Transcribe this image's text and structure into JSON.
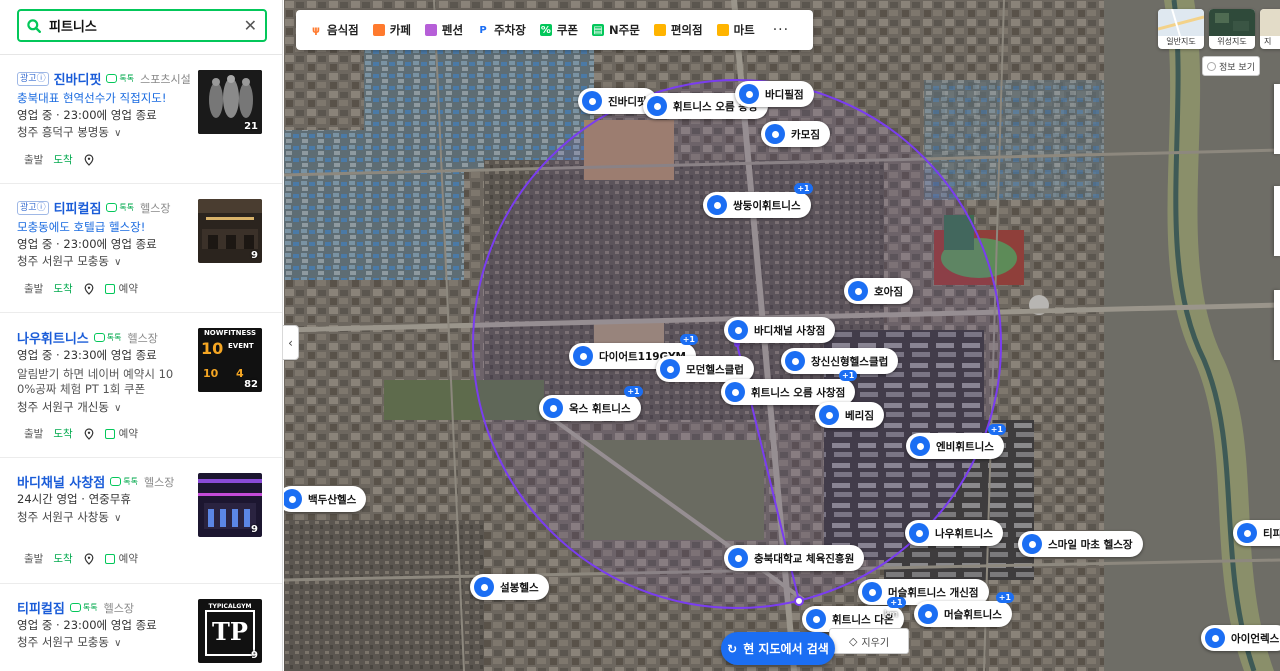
{
  "search": {
    "value": "피트니스",
    "clear_icon": "close-icon"
  },
  "places": [
    {
      "ad": "광고",
      "name": "진바디핏",
      "talk": "톡톡",
      "category": "스포츠시설",
      "promo": "충북대표 현역선수가 직접지도!",
      "status": "영업 중",
      "hours": "23:00에 영업 종료",
      "extra": "",
      "address": "청주 흥덕구 봉명동",
      "depart": "출발",
      "arrive": "도착",
      "reserve": "",
      "photo_count": "21"
    },
    {
      "ad": "광고",
      "name": "티피컬짐",
      "talk": "톡톡",
      "category": "헬스장",
      "promo": "모충동에도 호텔급 헬스장!",
      "status": "영업 중",
      "hours": "23:00에 영업 종료",
      "extra": "",
      "address": "청주 서원구 모충동",
      "depart": "출발",
      "arrive": "도착",
      "reserve": "예약",
      "photo_count": "9"
    },
    {
      "ad": "",
      "name": "나우휘트니스",
      "talk": "톡톡",
      "category": "헬스장",
      "promo": "",
      "status": "영업 중",
      "hours": "23:30에 영업 종료",
      "extra": "알림받기 하면 네이버 예약시 10",
      "extra2": "0%공짜 체험 PT 1회 쿠폰",
      "address": "청주 서원구 개신동",
      "depart": "출발",
      "arrive": "도착",
      "reserve": "예약",
      "photo_count": "82",
      "thumb_text": [
        "NOWFITNESS",
        "10",
        "EVENT",
        "10",
        "4"
      ]
    },
    {
      "ad": "",
      "name": "바디채널 사창점",
      "talk": "톡톡",
      "category": "헬스장",
      "promo": "",
      "status": "24시간 영업",
      "hours": "연중무휴",
      "extra": "",
      "address": "청주 서원구 사창동",
      "depart": "출발",
      "arrive": "도착",
      "reserve": "예약",
      "photo_count": "9"
    },
    {
      "ad": "",
      "name": "티피컬짐",
      "talk": "톡톡",
      "category": "헬스장",
      "promo": "",
      "status": "영업 중",
      "hours": "23:00에 영업 종료",
      "extra": "",
      "address": "청주 서원구 모충동",
      "depart": "",
      "arrive": "",
      "reserve": "",
      "photo_count": "9",
      "thumb_text": [
        "TYPICALGYM",
        "TP"
      ]
    }
  ],
  "categories": [
    {
      "label": "음식점",
      "icon": "fork-icon",
      "color": "#ff7a2e"
    },
    {
      "label": "카페",
      "icon": "cup-icon",
      "color": "#ff7a2e"
    },
    {
      "label": "펜션",
      "icon": "bed-icon",
      "color": "#b65fd8"
    },
    {
      "label": "주차장",
      "icon": "parking-icon",
      "color": "#1b6ef3"
    },
    {
      "label": "쿠폰",
      "icon": "coupon-icon",
      "color": "#03c75a"
    },
    {
      "label": "N주문",
      "icon": "order-icon",
      "color": "#03c75a"
    },
    {
      "label": "편의점",
      "icon": "store-icon",
      "color": "#ffb400"
    },
    {
      "label": "마트",
      "icon": "cart-icon",
      "color": "#ffb400"
    }
  ],
  "more_label": "···",
  "map_types": [
    {
      "label": "일반지도"
    },
    {
      "label": "위성지도"
    },
    {
      "label": "지"
    }
  ],
  "info_button": "정보 보기",
  "markers": [
    {
      "label": "진바디핏",
      "plus": ""
    },
    {
      "label": "휘트니스 오름 봉명",
      "plus": ""
    },
    {
      "label": "바디필점",
      "plus": ""
    },
    {
      "label": "카모짐",
      "plus": ""
    },
    {
      "label": "쌍둥이휘트니스",
      "plus": "+1"
    },
    {
      "label": "호아짐",
      "plus": ""
    },
    {
      "label": "바디채널 사창점",
      "plus": ""
    },
    {
      "label": "다이어트119GYM",
      "plus": "+1"
    },
    {
      "label": "창신신형헬스클럽",
      "plus": ""
    },
    {
      "label": "모던헬스클럽",
      "plus": ""
    },
    {
      "label": "휘트니스 오름 사창점",
      "plus": "+1"
    },
    {
      "label": "옥스 휘트니스",
      "plus": "+1"
    },
    {
      "label": "베리짐",
      "plus": ""
    },
    {
      "label": "엔비휘트니스",
      "plus": "+1"
    },
    {
      "label": "백두산헬스",
      "plus": ""
    },
    {
      "label": "나우휘트니스",
      "plus": ""
    },
    {
      "label": "스마일 마초 헬스장",
      "plus": ""
    },
    {
      "label": "티피",
      "plus": ""
    },
    {
      "label": "충북대학교 체육진흥원",
      "plus": ""
    },
    {
      "label": "설봉헬스",
      "plus": ""
    },
    {
      "label": "머슬휘트니스 개신점",
      "plus": ""
    },
    {
      "label": "휘트니스 다온",
      "plus": "+1"
    },
    {
      "label": "머슬휘트니스",
      "plus": "+1"
    },
    {
      "label": "아이언렉스",
      "plus": ""
    }
  ],
  "map_search_button": "현 지도에서 검색",
  "erase_button": "지우기",
  "scale_unit": "km"
}
